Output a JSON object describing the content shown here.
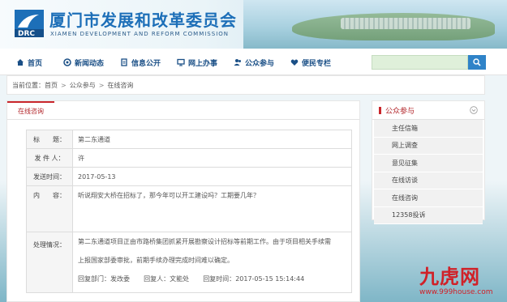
{
  "header": {
    "title_cn": "厦门市发展和改革委员会",
    "title_en": "XIAMEN DEVELOPMENT AND REFORM COMMISSION",
    "logo_text": "DRC"
  },
  "nav": {
    "items": [
      {
        "label": "首页",
        "icon": "home-icon"
      },
      {
        "label": "新闻动态",
        "icon": "news-icon"
      },
      {
        "label": "信息公开",
        "icon": "document-icon"
      },
      {
        "label": "网上办事",
        "icon": "monitor-icon"
      },
      {
        "label": "公众参与",
        "icon": "people-icon"
      },
      {
        "label": "便民专栏",
        "icon": "heart-icon"
      }
    ],
    "search": {
      "placeholder": "",
      "value": ""
    }
  },
  "breadcrumb": {
    "prefix": "当前位置：",
    "items": [
      "首页",
      "公众参与",
      "在线咨询"
    ]
  },
  "main": {
    "tab": "在线咨询",
    "rows": [
      {
        "label": "标　　题：",
        "value": "第二东通道"
      },
      {
        "label": "发 件 人：",
        "value": "许"
      },
      {
        "label": "发送时间：",
        "value": "2017-05-13"
      },
      {
        "label": "内　　容：",
        "value": "听说翔安大桥在招标了，那今年可以开工建设吗？工期要几年？"
      }
    ],
    "reply": {
      "label": "处理情况：",
      "line1": "第二东通道项目正由市路桥集团抓紧开展勘察设计招标等前期工作。由于项目相关手续需",
      "line2": "上报国家部委审批，前期手续办理完成时间难以确定。",
      "dept_label": "回复部门：",
      "dept": "发改委",
      "person_label": "回复人：",
      "person": "文能处",
      "time_label": "回复时间：",
      "time": "2017-05-15 15:14:44"
    }
  },
  "sidebar": {
    "title": "公众参与",
    "items": [
      "主任信箱",
      "网上调查",
      "意见征集",
      "在线访谈",
      "在线咨询",
      "12358投诉"
    ]
  },
  "watermark": {
    "big": "九虎网",
    "small": "www.999house.com"
  },
  "colors": {
    "nav_text": "#1a4f86",
    "accent_red": "#c9262b",
    "search_button": "#2f83c8",
    "title_blue": "#1d6fb8"
  }
}
